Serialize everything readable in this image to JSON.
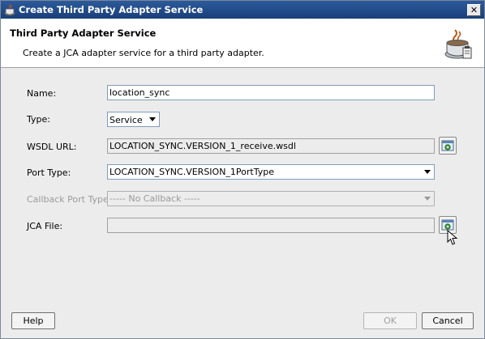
{
  "window": {
    "title": "Create Third Party Adapter Service",
    "close_glyph": "✕"
  },
  "header": {
    "title": "Third Party Adapter Service",
    "description": "Create a JCA adapter service for a third party adapter.",
    "icon": "java-coffee-cup-icon"
  },
  "form": {
    "name": {
      "label": "Name:",
      "value": "location_sync"
    },
    "type": {
      "label": "Type:",
      "selected": "Service"
    },
    "wsdl_url": {
      "label": "WSDL URL:",
      "value": "LOCATION_SYNC.VERSION_1_receive.wsdl"
    },
    "port_type": {
      "label": "Port Type:",
      "selected": "LOCATION_SYNC.VERSION_1PortType"
    },
    "callback_port_type": {
      "label": "Callback Port Type:",
      "selected": "----- No Callback -----",
      "enabled": false
    },
    "jca_file": {
      "label": "JCA File:",
      "value": ""
    }
  },
  "footer": {
    "help_label": "Help",
    "ok_label": "OK",
    "cancel_label": "Cancel"
  },
  "colors": {
    "titlebar": "#1a3f79",
    "dialog_bg": "#ececec",
    "field_border": "#7f9db9"
  }
}
